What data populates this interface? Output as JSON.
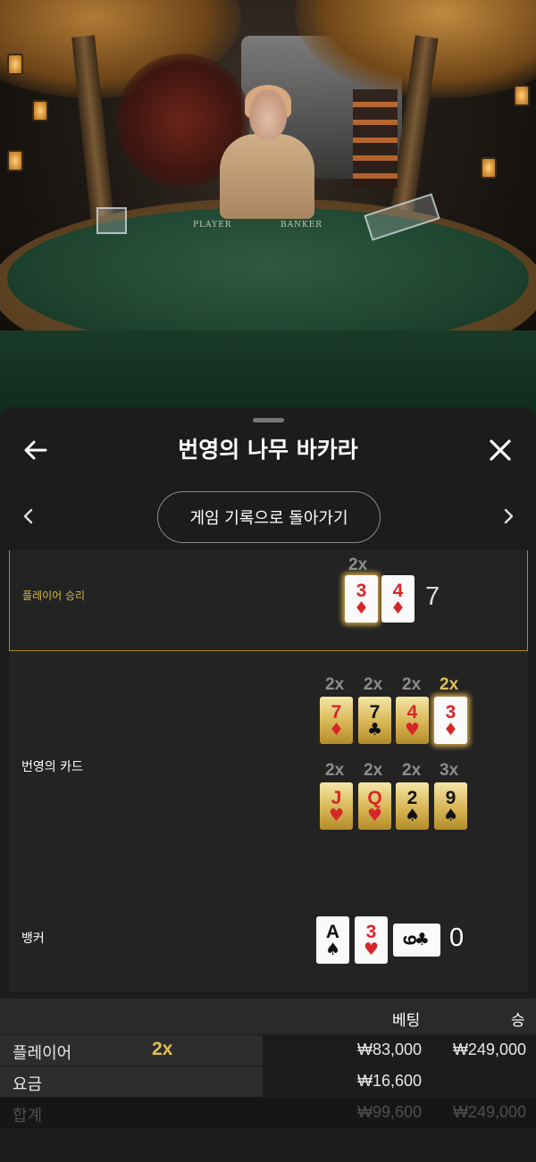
{
  "video": {
    "felt_labels": {
      "player": "PLAYER",
      "banker": "BANKER"
    }
  },
  "header": {
    "title": "번영의 나무 바카라",
    "back_icon": "arrow-left-icon",
    "close_icon": "close-icon"
  },
  "history_nav": {
    "back_to_history_label": "게임 기록으로 돌아가기",
    "prev_icon": "chevron-left-icon",
    "next_icon": "chevron-right-icon"
  },
  "result": {
    "player_row": {
      "label": "플레이어 승리",
      "multiplier": "2x",
      "cards": [
        {
          "rank": "3",
          "suit": "♦",
          "color": "red",
          "highlight": true
        },
        {
          "rank": "4",
          "suit": "♦",
          "color": "red",
          "highlight": false
        }
      ],
      "total": "7"
    },
    "prosperity_row": {
      "label": "번영의 카드",
      "top_cards": [
        {
          "rank": "7",
          "suit": "♦",
          "color": "red",
          "multiplier": "2x",
          "highlight": false
        },
        {
          "rank": "7",
          "suit": "♣",
          "color": "black",
          "multiplier": "2x",
          "highlight": false
        },
        {
          "rank": "4",
          "suit": "♥",
          "color": "red",
          "multiplier": "2x",
          "highlight": false
        },
        {
          "rank": "3",
          "suit": "♦",
          "color": "red",
          "multiplier": "2x",
          "highlight": true
        }
      ],
      "bottom_cards": [
        {
          "rank": "J",
          "suit": "♥",
          "color": "red",
          "multiplier": "2x"
        },
        {
          "rank": "Q",
          "suit": "♥",
          "color": "red",
          "multiplier": "2x"
        },
        {
          "rank": "2",
          "suit": "♠",
          "color": "black",
          "multiplier": "2x"
        },
        {
          "rank": "9",
          "suit": "♠",
          "color": "black",
          "multiplier": "3x"
        }
      ]
    },
    "banker_row": {
      "label": "뱅커",
      "cards": [
        {
          "rank": "A",
          "suit": "♠",
          "color": "black"
        },
        {
          "rank": "3",
          "suit": "♥",
          "color": "red"
        },
        {
          "rank": "9",
          "suit": "♣",
          "color": "black",
          "sideways": true
        }
      ],
      "total": "0"
    }
  },
  "bets": {
    "headers": {
      "bet": "베팅",
      "win": "승"
    },
    "rows": [
      {
        "label": "플레이어",
        "multiplier": "2x",
        "bet": "₩83,000",
        "win": "₩249,000"
      },
      {
        "label": "요금",
        "bet": "₩16,600",
        "win": ""
      }
    ],
    "total": {
      "label": "합계",
      "bet": "₩99,600",
      "win": "₩249,000"
    }
  },
  "colors": {
    "accent_gold": "#e2bf52",
    "card_red": "#d7262a",
    "panel_bg": "#1c1c1c"
  }
}
